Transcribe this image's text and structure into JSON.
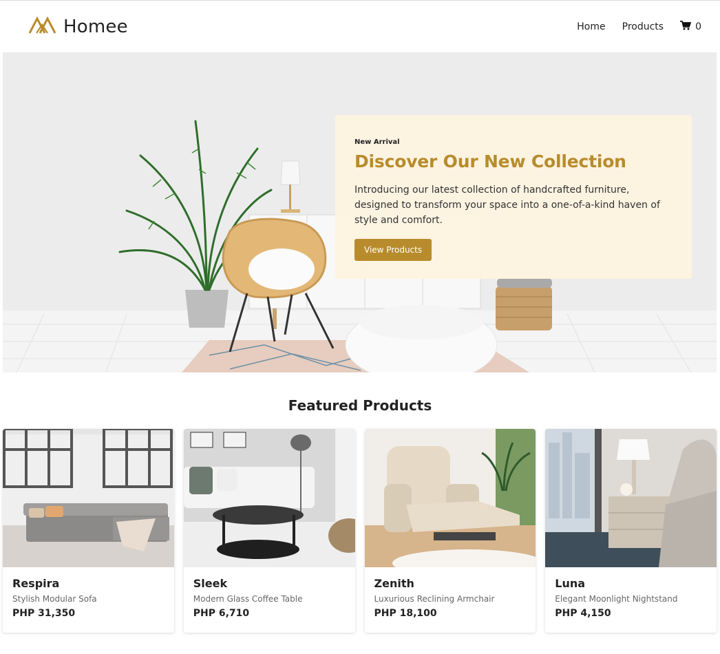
{
  "brand": {
    "name": "Homee"
  },
  "nav": {
    "home": "Home",
    "products": "Products",
    "cart_count": "0"
  },
  "hero": {
    "eyebrow": "New Arrival",
    "title": "Discover Our New Collection",
    "text": "Introducing our latest collection of handcrafted furniture, designed to transform your space into a one-of-a-kind haven of style and comfort.",
    "button": "View Products"
  },
  "featured": {
    "title": "Featured Products",
    "products": [
      {
        "name": "Respira",
        "desc": "Stylish Modular Sofa",
        "price": "PHP 31,350"
      },
      {
        "name": "Sleek",
        "desc": "Modern Glass Coffee Table",
        "price": "PHP 6,710"
      },
      {
        "name": "Zenith",
        "desc": "Luxurious Reclining Armchair",
        "price": "PHP 18,100"
      },
      {
        "name": "Luna",
        "desc": "Elegant Moonlight Nightstand",
        "price": "PHP 4,150"
      }
    ]
  },
  "colors": {
    "accent": "#b88c2c",
    "hero_card": "#fdf3e0"
  }
}
